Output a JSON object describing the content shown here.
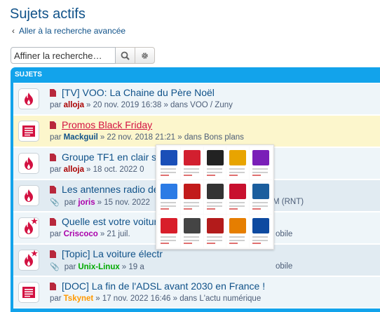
{
  "page": {
    "title": "Sujets actifs",
    "back_link": "Aller à la recherche avancée",
    "search_placeholder": "Affiner la recherche…"
  },
  "table": {
    "header": "SUJETS",
    "rows": [
      {
        "title": "[TV] VOO: La Chaine du Père Noël",
        "by": "par",
        "author": "alloja",
        "author_color": "#aa0000",
        "rest": "» 20 nov. 2019 16:38 » dans VOO / Zuny",
        "icon": "fire-icon",
        "attach": false,
        "style": "bg1"
      },
      {
        "title": "Promos Black Friday",
        "by": "par",
        "author": "Mackguil",
        "author_color": "#105289",
        "rest": "» 22 nov. 2018 21:21 » dans Bons plans",
        "icon": "list-icon",
        "attach": false,
        "style": "hl"
      },
      {
        "title": "Groupe TF1 en clair s",
        "by": "par",
        "author": "alloja",
        "author_color": "#aa0000",
        "rest": "» 18 oct. 2022 0",
        "icon": "fire-icon",
        "attach": false,
        "style": "bg1"
      },
      {
        "title": "Les antennes radio de",
        "by": "par",
        "author": "joris",
        "author_color": "#aa00aa",
        "rest": "» 15 nov. 2022",
        "rest_right": "M (RNT)",
        "icon": "fire-icon",
        "attach": true,
        "style": "bg2"
      },
      {
        "title": "Quelle est votre voiture",
        "by": "par",
        "author": "Criscoco",
        "author_color": "#aa00aa",
        "rest": "» 21 juil.",
        "rest_right": "obile",
        "icon": "fire-star-icon",
        "attach": false,
        "style": "bg1"
      },
      {
        "title": "[Topic] La voiture électr",
        "by": "par",
        "author": "Unix-Linux",
        "author_color": "#00aa00",
        "rest": "» 19 a",
        "rest_right": "obile",
        "icon": "fire-star-icon",
        "attach": true,
        "style": "bg2"
      },
      {
        "title": "[DOC] La fin de l'ADSL avant 2030 en France !",
        "by": "par",
        "author": "Tskynet",
        "author_color": "#ff9900",
        "rest": "» 17 nov. 2022 16:46 » dans L'actu numérique",
        "icon": "list-icon",
        "attach": false,
        "style": "bg1"
      }
    ]
  },
  "colors": {
    "accent": "#12a3eb",
    "link": "#105289",
    "hot": "#d31141"
  }
}
